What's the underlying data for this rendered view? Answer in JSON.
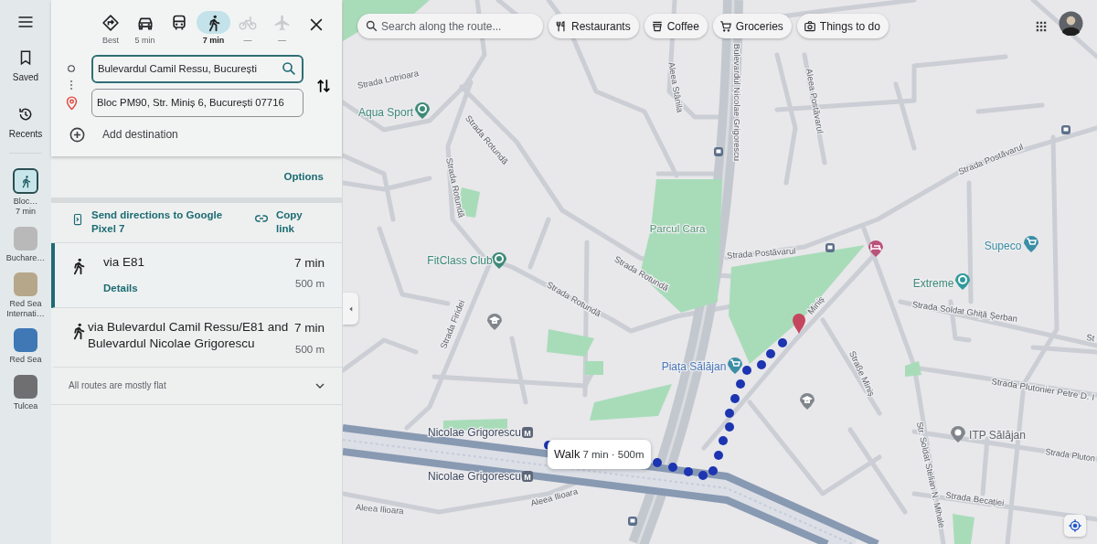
{
  "rail": {
    "items": [
      {
        "kind": "saved",
        "label": "Saved"
      },
      {
        "kind": "recents",
        "label": "Recents"
      }
    ],
    "recent_places": [
      {
        "kind": "route",
        "label": "Bloc…",
        "detail": "7 min",
        "selected": true
      },
      {
        "kind": "photo",
        "label": "Buchare…",
        "selected": false
      },
      {
        "kind": "photo",
        "label": "Red Sea Internati…",
        "selected": false
      },
      {
        "kind": "photo",
        "label": "Red Sea",
        "selected": false
      },
      {
        "kind": "photo",
        "label": "Tulcea",
        "selected": false
      }
    ]
  },
  "directions": {
    "modes": [
      {
        "kind": "best",
        "label": "Best",
        "selected": false,
        "disabled": false
      },
      {
        "kind": "car",
        "label": "5 min",
        "selected": false,
        "disabled": false
      },
      {
        "kind": "transit",
        "selected": false,
        "disabled": false
      },
      {
        "kind": "walk",
        "label": "7 min",
        "selected": true,
        "disabled": false
      },
      {
        "kind": "bike",
        "label": "—",
        "selected": false,
        "disabled": true
      },
      {
        "kind": "flight",
        "label": "—",
        "selected": false,
        "disabled": true
      }
    ],
    "stops": [
      {
        "kind": "origin",
        "value": "Bulevardul Camil Ressu, București",
        "focused": true
      },
      {
        "kind": "destination",
        "value": "Bloc PM90, Str. Miniș 6, București 07716",
        "focused": false
      }
    ],
    "add_destination": "Add destination",
    "options": "Options",
    "share": [
      {
        "kind": "send",
        "label": "Send directions to Google Pixel 7"
      },
      {
        "kind": "copy",
        "label": "Copy link"
      }
    ],
    "routes": [
      {
        "via": "via E81",
        "time": "7 min",
        "distance": "500 m",
        "details": "Details",
        "selected": true
      },
      {
        "via": "via Bulevardul Camil Ressu/E81 and Bulevardul Nicolae Grigorescu",
        "time": "7 min",
        "distance": "500 m",
        "selected": false
      }
    ],
    "terrain_note": "All routes are mostly flat"
  },
  "map": {
    "search": {
      "placeholder": "Search along the route..."
    },
    "chips": [
      {
        "kind": "restaurants",
        "label": "Restaurants"
      },
      {
        "kind": "coffee",
        "label": "Coffee"
      },
      {
        "kind": "groceries",
        "label": "Groceries"
      },
      {
        "kind": "attractions",
        "label": "Things to do"
      }
    ],
    "labels": [
      {
        "text": "Strada Lotrioara",
        "kind": "street"
      },
      {
        "text": "Bulevardul Nicolae Grigorescu",
        "kind": "street"
      },
      {
        "text": "Aleea Stânila",
        "kind": "street"
      },
      {
        "text": "Aleea Postăvarul",
        "kind": "street"
      },
      {
        "text": "Aqua Sport",
        "kind": "place"
      },
      {
        "text": "Strada Rotundă",
        "kind": "street"
      },
      {
        "text": "Strada Postăvarul",
        "kind": "street"
      },
      {
        "text": "Strada Rotundă",
        "kind": "street"
      },
      {
        "text": "Parcul Cara",
        "kind": "park"
      },
      {
        "text": "Supeco",
        "kind": "store"
      },
      {
        "text": "Strada Postăvarul",
        "kind": "street"
      },
      {
        "text": "FitClass Club",
        "kind": "place"
      },
      {
        "text": "Strada Rotundă",
        "kind": "street"
      },
      {
        "text": "Extreme",
        "kind": "place"
      },
      {
        "text": "Miniș",
        "kind": "street"
      },
      {
        "text": "Strada Rotundă",
        "kind": "street"
      },
      {
        "text": "Strada Soldat Ghiță Șerban",
        "kind": "street"
      },
      {
        "text": "Strada Firidei",
        "kind": "street"
      },
      {
        "text": "St",
        "kind": "street"
      },
      {
        "text": "Piața Sălăjan",
        "kind": "square"
      },
      {
        "text": "Straße Miniș",
        "kind": "street"
      },
      {
        "text": "Strada Plutonier Petre D. I",
        "kind": "street"
      },
      {
        "text": "ITP Sălăjan",
        "kind": "service"
      },
      {
        "text": "Nicolae Grigorescu",
        "kind": "station",
        "badge": "M"
      },
      {
        "text": "Strada Pluton",
        "kind": "street"
      },
      {
        "text": "Nicolae Grigorescu",
        "kind": "station",
        "badge": "M"
      },
      {
        "text": "Str. Soldat Stelian N. Mihale",
        "kind": "street"
      },
      {
        "text": "Aleea Ilioara",
        "kind": "street"
      },
      {
        "text": "Strada Becației",
        "kind": "street"
      },
      {
        "text": "Aleea Ilioara",
        "kind": "street"
      }
    ],
    "tooltip": {
      "mode": "Walk",
      "detail": "7 min · 500m"
    }
  }
}
